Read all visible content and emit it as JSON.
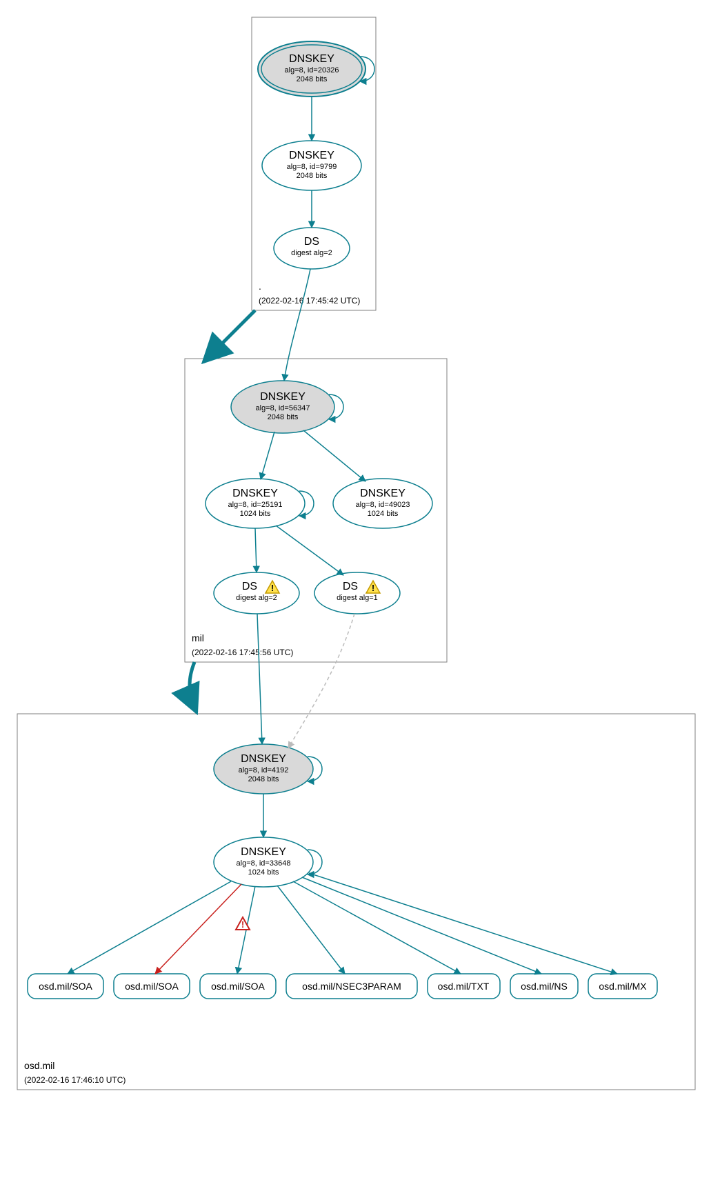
{
  "zones": {
    "root": {
      "label": ".",
      "timestamp": "(2022-02-16 17:45:42 UTC)"
    },
    "mil": {
      "label": "mil",
      "timestamp": "(2022-02-16 17:45:56 UTC)"
    },
    "osd": {
      "label": "osd.mil",
      "timestamp": "(2022-02-16 17:46:10 UTC)"
    }
  },
  "nodes": {
    "dnskey_root_20326": {
      "title": "DNSKEY",
      "line2": "alg=8, id=20326",
      "line3": "2048 bits"
    },
    "dnskey_root_9799": {
      "title": "DNSKEY",
      "line2": "alg=8, id=9799",
      "line3": "2048 bits"
    },
    "ds_root": {
      "title": "DS",
      "line2": "digest alg=2",
      "line3": ""
    },
    "dnskey_mil_56347": {
      "title": "DNSKEY",
      "line2": "alg=8, id=56347",
      "line3": "2048 bits"
    },
    "dnskey_mil_25191": {
      "title": "DNSKEY",
      "line2": "alg=8, id=25191",
      "line3": "1024 bits"
    },
    "dnskey_mil_49023": {
      "title": "DNSKEY",
      "line2": "alg=8, id=49023",
      "line3": "1024 bits"
    },
    "ds_mil_2": {
      "title": "DS",
      "line2": "digest alg=2",
      "line3": ""
    },
    "ds_mil_1": {
      "title": "DS",
      "line2": "digest alg=1",
      "line3": ""
    },
    "dnskey_osd_4192": {
      "title": "DNSKEY",
      "line2": "alg=8, id=4192",
      "line3": "2048 bits"
    },
    "dnskey_osd_33648": {
      "title": "DNSKEY",
      "line2": "alg=8, id=33648",
      "line3": "1024 bits"
    }
  },
  "records": {
    "r1": "osd.mil/SOA",
    "r2": "osd.mil/SOA",
    "r3": "osd.mil/SOA",
    "r4": "osd.mil/NSEC3PARAM",
    "r5": "osd.mil/TXT",
    "r6": "osd.mil/NS",
    "r7": "osd.mil/MX"
  },
  "colors": {
    "teal": "#0d7f8f",
    "zoneBorder": "#7f7f7f",
    "nodeFillGrey": "#d9d9d9",
    "nodeFillWhite": "#ffffff",
    "red": "#c8201d",
    "grey": "#bbbbbb",
    "warnYellowFill": "#ffe14d",
    "warnYellowStroke": "#c49a00",
    "errRedStroke": "#c8201d"
  }
}
